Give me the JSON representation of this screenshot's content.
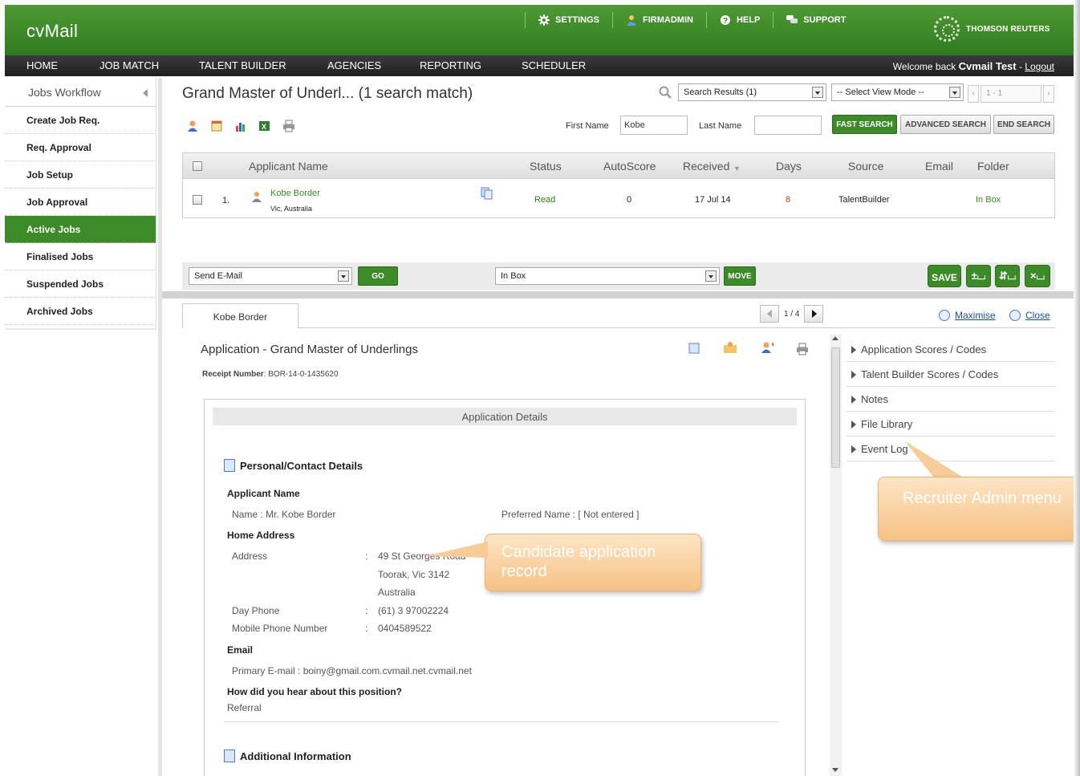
{
  "app": {
    "logo": "cvMail",
    "brand": "THOMSON REUTERS"
  },
  "toplinks": [
    {
      "label": "SETTINGS",
      "icon": "gear-icon"
    },
    {
      "label": "FIRMADMIN",
      "icon": "admin-person-icon"
    },
    {
      "label": "HELP",
      "icon": "help-icon"
    },
    {
      "label": "SUPPORT",
      "icon": "speech-bubbles-icon"
    }
  ],
  "nav": {
    "items": [
      "HOME",
      "JOB MATCH",
      "TALENT BUILDER",
      "AGENCIES",
      "REPORTING",
      "SCHEDULER"
    ],
    "welcome_prefix": "Welcome back",
    "user": "Cvmail Test",
    "logout": "Logout"
  },
  "sidebar": {
    "title": "Jobs Workflow",
    "items": [
      "Create Job Req.",
      "Req. Approval",
      "Job Setup",
      "Job Approval",
      "Active Jobs",
      "Finalised Jobs",
      "Suspended Jobs",
      "Archived Jobs"
    ],
    "active": "Active Jobs"
  },
  "main": {
    "title": "Grand Master of Underl... (1 search match)",
    "search_results_select": "Search Results (1)",
    "view_mode_select": "-- Select View Mode --",
    "pager": "1 - 1",
    "first_name_label": "First Name",
    "first_name_value": "Kobe",
    "last_name_label": "Last Name",
    "last_name_value": "",
    "fast_search": "FAST SEARCH",
    "advanced_search": "ADVANCED SEARCH",
    "end_search": "END SEARCH"
  },
  "table": {
    "columns": [
      "Applicant Name",
      "Status",
      "AutoScore",
      "Received",
      "Days",
      "Source",
      "Email",
      "Folder"
    ],
    "rows": [
      {
        "num": "1.",
        "name": "Kobe Border",
        "location": "Vic, Australia",
        "status": "Read",
        "autoscore": "0",
        "received": "17 Jul 14",
        "days": "8",
        "source": "TalentBuilder",
        "email": "",
        "folder": "In Box"
      }
    ]
  },
  "actions": {
    "send_select": "Send E-Mail",
    "go": "GO",
    "folder_select": "In Box",
    "move": "MOVE",
    "save": "SAVE"
  },
  "detail": {
    "tab": "Kobe Border",
    "pager": "1 / 4",
    "maximise": "Maximise",
    "close": "Close",
    "app_title": "Application - Grand Master of Underlings",
    "receipt_label": "Receipt Number",
    "receipt_value": "BOR-14-0-1435620",
    "box_header": "Application Details",
    "section1": "Personal/Contact Details",
    "applicant_name_h": "Applicant Name",
    "name_label": "Name",
    "name_value": "Mr. Kobe Border",
    "preferred_name_label": "Preferred Name",
    "preferred_name_value": "[ Not entered ]",
    "home_address_h": "Home Address",
    "address_label": "Address",
    "address_lines": [
      "49 St Georges Road",
      "Toorak, Vic 3142",
      "Australia"
    ],
    "day_phone_label": "Day Phone",
    "day_phone_value": "(61) 3 97002224",
    "mobile_label": "Mobile Phone Number",
    "mobile_value": "0404589522",
    "email_h": "Email",
    "primary_email_label": "Primary E-mail",
    "primary_email_value": "boiny@gmail.com.cvmail.net.cvmail.net",
    "hear_h": "How did you hear about this position?",
    "hear_value": "Referral",
    "section2": "Additional Information"
  },
  "right_menu": [
    "Application Scores / Codes",
    "Talent Builder Scores / Codes",
    "Notes",
    "File Library",
    "Event Log"
  ],
  "callouts": {
    "candidate": "Candidate application record",
    "recruiter": "Recruiter Admin menu"
  },
  "colors": {
    "header_green": "#3c8a28",
    "nav_dark": "#2a2a2a",
    "read_status": "#2f7a1e",
    "days_red": "#e0301e",
    "link_green": "#3a8a22"
  }
}
